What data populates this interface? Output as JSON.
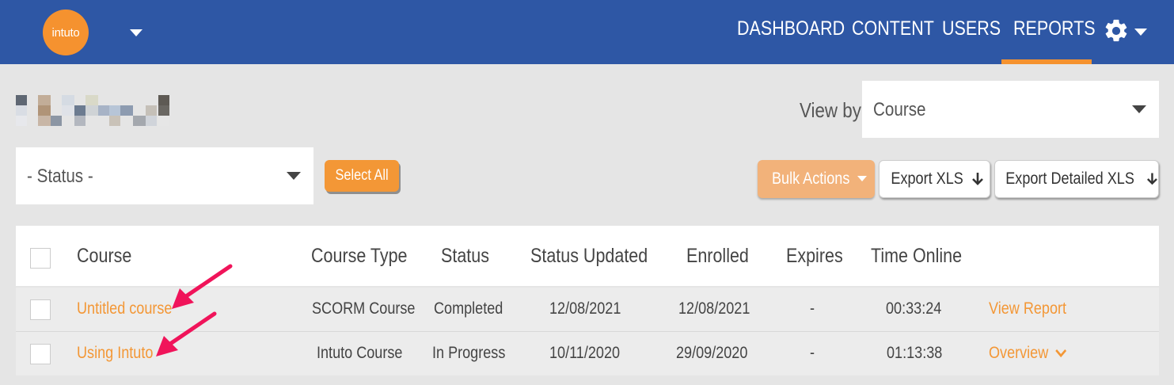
{
  "app": {
    "logo_text": "intuto",
    "brand_color": "#2e57a5",
    "accent_color": "#f39736"
  },
  "nav": {
    "items": [
      {
        "label": "DASHBOARD"
      },
      {
        "label": "CONTENT"
      },
      {
        "label": "USERS"
      },
      {
        "label": "REPORTS",
        "active": true
      }
    ],
    "settings_icon": "gear-icon"
  },
  "filters": {
    "view_by_label": "View by",
    "view_by_value": "Course",
    "status_value": "- Status -",
    "select_all_label": "Select All"
  },
  "actions": {
    "bulk_actions_label": "Bulk Actions",
    "export_xls_label": "Export XLS",
    "export_detailed_label": "Export Detailed XLS"
  },
  "table": {
    "columns": [
      "Course",
      "Course Type",
      "Status",
      "Status Updated",
      "Enrolled",
      "Expires",
      "Time Online"
    ],
    "rows": [
      {
        "course": "Untitled course",
        "course_type": "SCORM Course",
        "status": "Completed",
        "status_updated": "12/08/2021",
        "enrolled": "12/08/2021",
        "expires": "-",
        "time_online": "00:33:24",
        "action": "View Report"
      },
      {
        "course": "Using Intuto",
        "course_type": "Intuto Course",
        "status": "In Progress",
        "status_updated": "10/11/2020",
        "enrolled": "29/09/2020",
        "expires": "-",
        "time_online": "01:13:38",
        "action": "Overview"
      }
    ]
  },
  "annotations": {
    "arrow_color": "#f0145a"
  }
}
